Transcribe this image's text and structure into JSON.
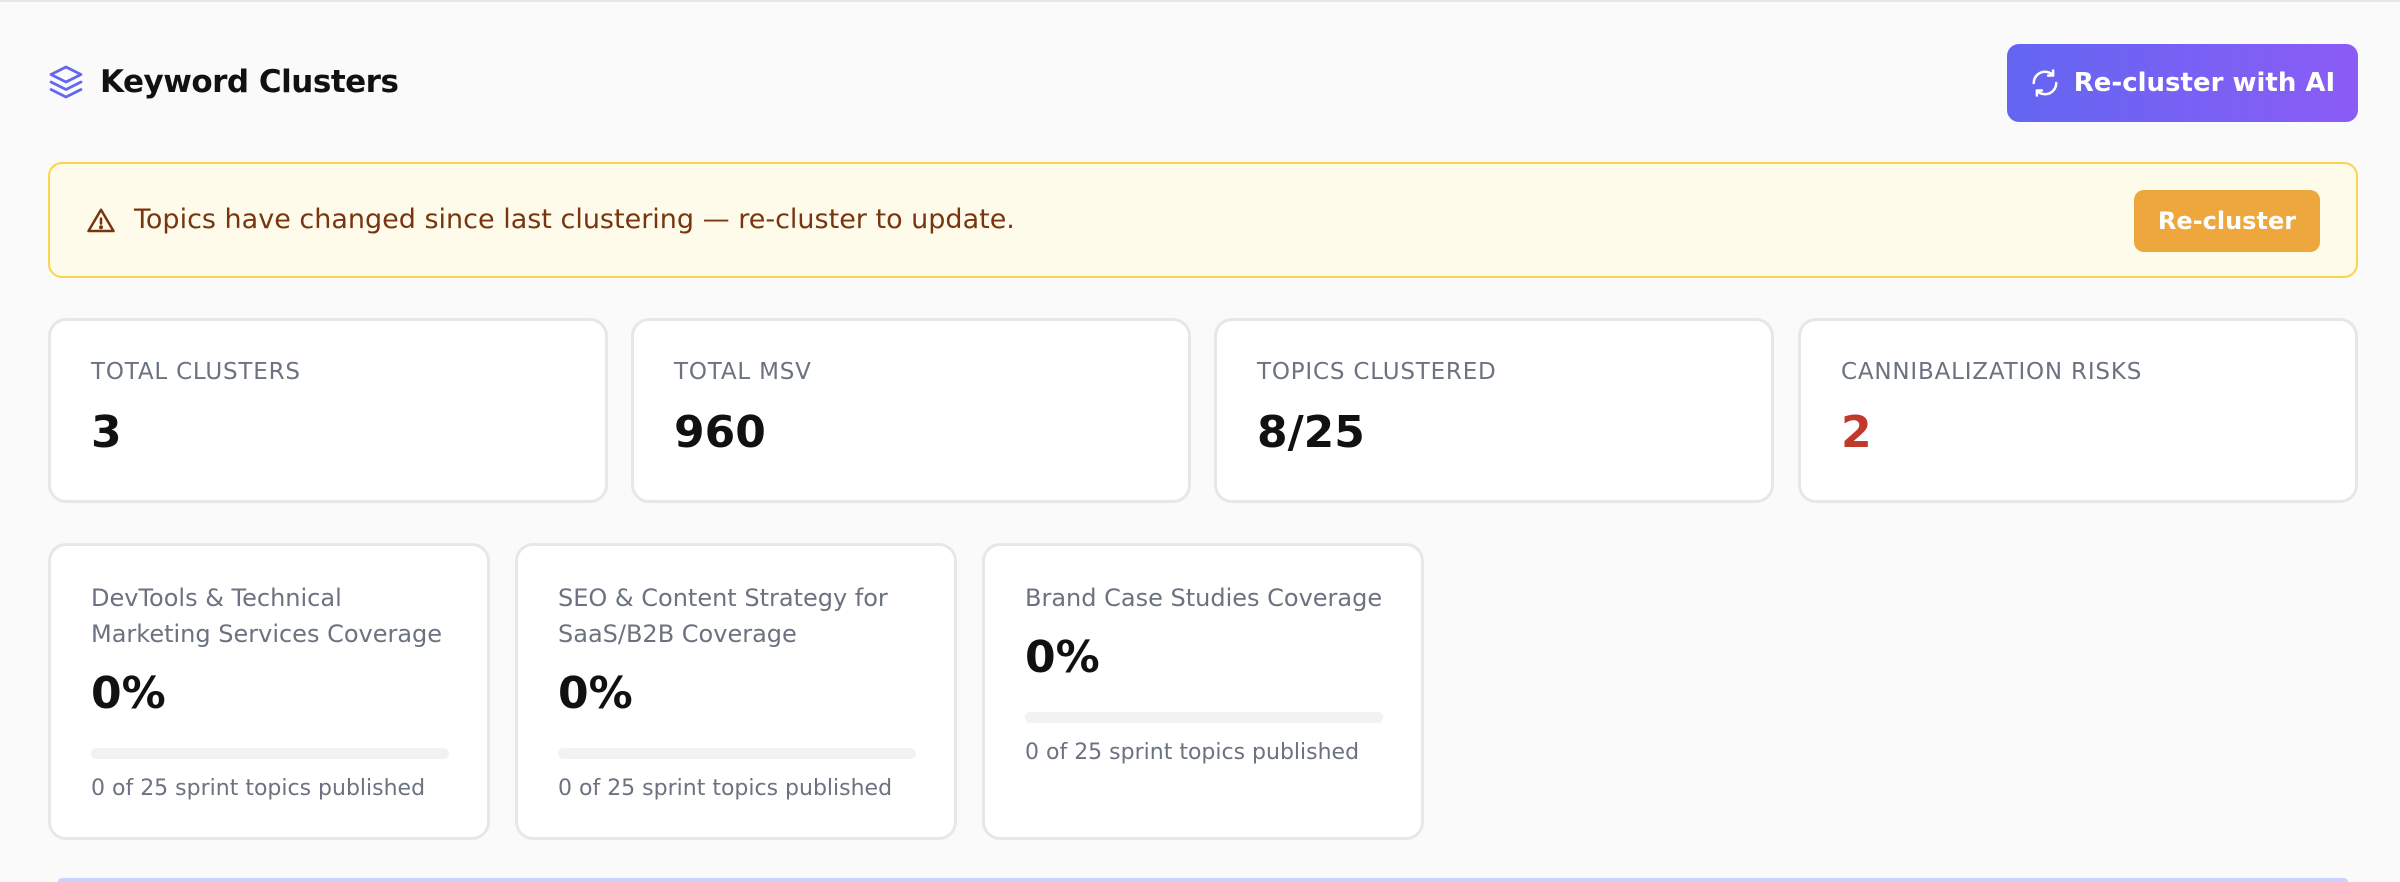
{
  "header": {
    "title": "Keyword Clusters",
    "title_icon": "layers-icon",
    "action_label": "Re-cluster with AI",
    "action_icon": "refresh-icon"
  },
  "alert": {
    "icon": "warning-triangle-icon",
    "message": "Topics have changed since last clustering — re-cluster to update.",
    "button_label": "Re-cluster"
  },
  "stats": [
    {
      "label": "TOTAL CLUSTERS",
      "value": "3"
    },
    {
      "label": "TOTAL MSV",
      "value": "960"
    },
    {
      "label": "TOPICS CLUSTERED",
      "value": "8/25"
    },
    {
      "label": "CANNIBALIZATION RISKS",
      "value": "2",
      "value_color": "#c0392b"
    }
  ],
  "coverage": [
    {
      "title": "DevTools & Technical Marketing Services Coverage",
      "percent_label": "0%",
      "progress": 0,
      "subtitle": "0 of 25 sprint topics published"
    },
    {
      "title": "SEO & Content Strategy for SaaS/B2B Coverage",
      "percent_label": "0%",
      "progress": 0,
      "subtitle": "0 of 25 sprint topics published"
    },
    {
      "title": "Brand Case Studies Coverage",
      "percent_label": "0%",
      "progress": 0,
      "subtitle": "0 of 25 sprint topics published"
    }
  ],
  "colors": {
    "accent_start": "#6366f1",
    "accent_end": "#8b5cf6",
    "warning_bg": "#fffbeb",
    "warning_border": "#fcd34d",
    "warning_button": "#eda73d",
    "danger": "#c0392b"
  }
}
